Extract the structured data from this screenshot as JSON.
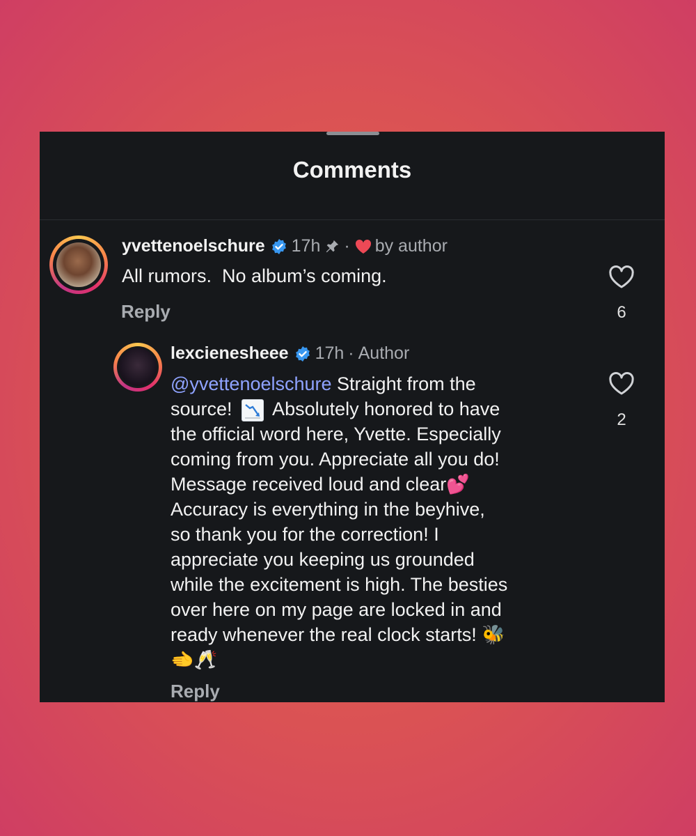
{
  "sheet": {
    "title": "Comments"
  },
  "comments": [
    {
      "username": "yvettenoelschure",
      "time": "17h",
      "liked_by": "by author",
      "text": "All rumors.  No album’s coming.",
      "reply_label": "Reply",
      "likes": "6"
    },
    {
      "username": "lexcienesheee",
      "time": "17h",
      "badge": "Author",
      "mention": "@yvettenoelschure",
      "lines": [
        " Straight from the",
        "source! ",
        " Absolutely honored to have",
        "the official word here, Yvette. Especially",
        "coming from you. Appreciate all you do!",
        "Message received loud and clear💕",
        "Accuracy is everything in the beyhive,",
        "so thank you for the correction! I",
        "appreciate you keeping us grounded",
        "while the excitement is high. The besties",
        "over here on my page are locked in and",
        "ready whenever the real clock starts! 🐝",
        "🫲🥂"
      ],
      "reply_label": "Reply",
      "likes": "2"
    }
  ],
  "colors": {
    "panel_bg": "#16181b",
    "text": "#f2f2f2",
    "muted": "#a9acb1",
    "mention": "#8fa3ff",
    "verified": "#3897f0",
    "like_red": "#ed4956"
  },
  "icons": [
    "verified-badge-icon",
    "pin-icon",
    "heart-filled-icon",
    "heart-outline-icon",
    "chart-decreasing-icon",
    "avatar"
  ]
}
